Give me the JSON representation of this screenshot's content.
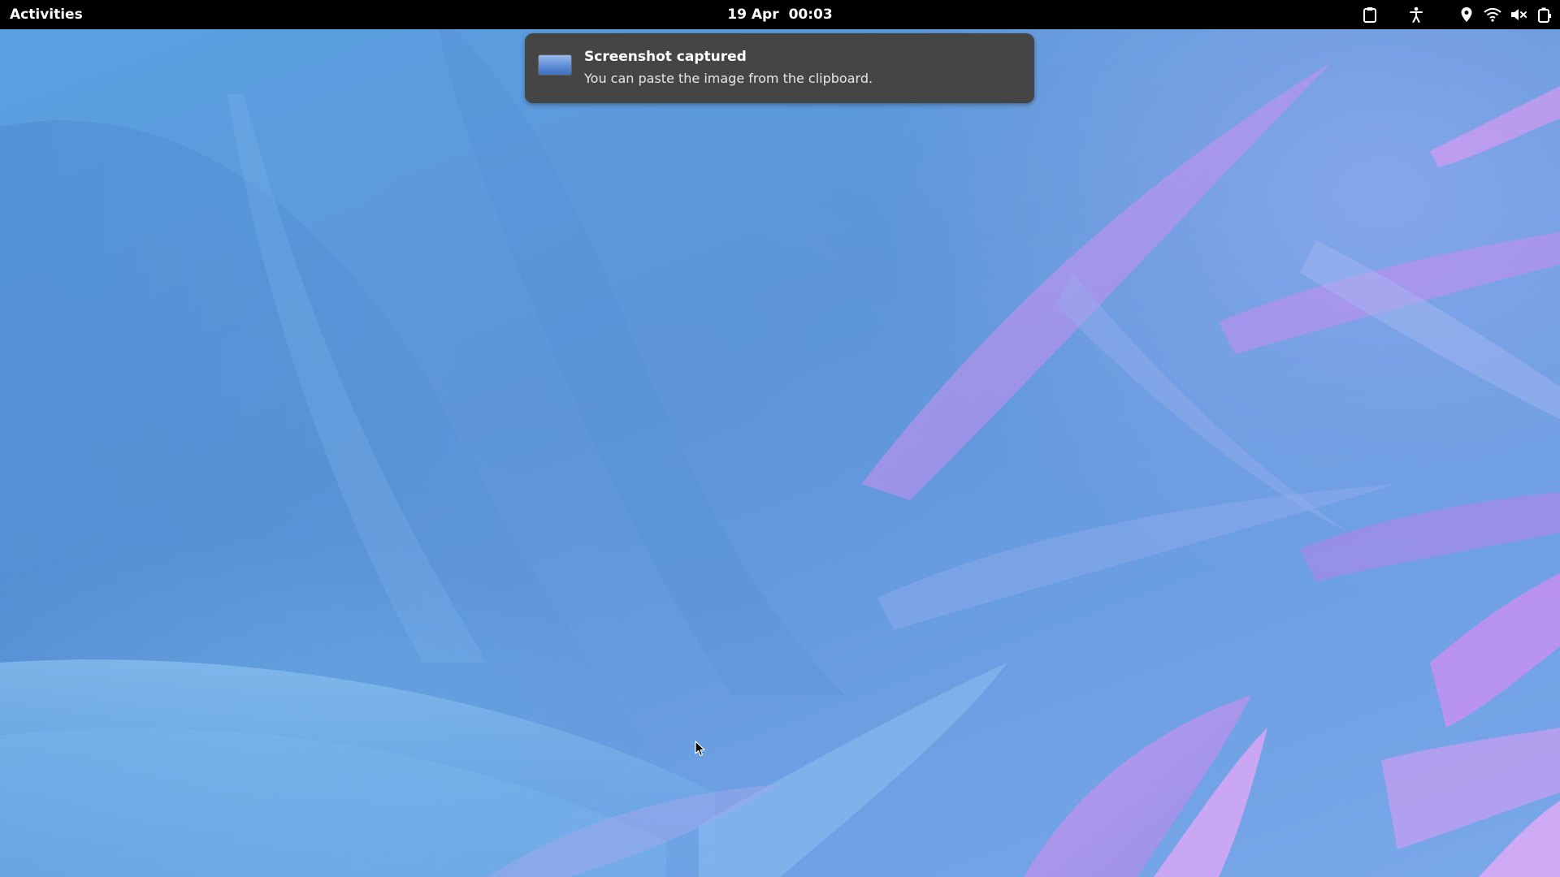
{
  "top_bar": {
    "activities_label": "Activities",
    "date": "19 Apr",
    "time": "00:03"
  },
  "status_icons": [
    "clipboard-icon",
    "accessibility-icon",
    "location-icon",
    "wifi-icon",
    "volume-muted-icon",
    "battery-icon"
  ],
  "notification": {
    "title": "Screenshot captured",
    "body": "You can paste the image from the clipboard."
  },
  "colors": {
    "top_bar": "#000000",
    "notification_bg": "#454545",
    "wallpaper_blue": "#5f96da",
    "wallpaper_pink": "#c98cf0"
  }
}
